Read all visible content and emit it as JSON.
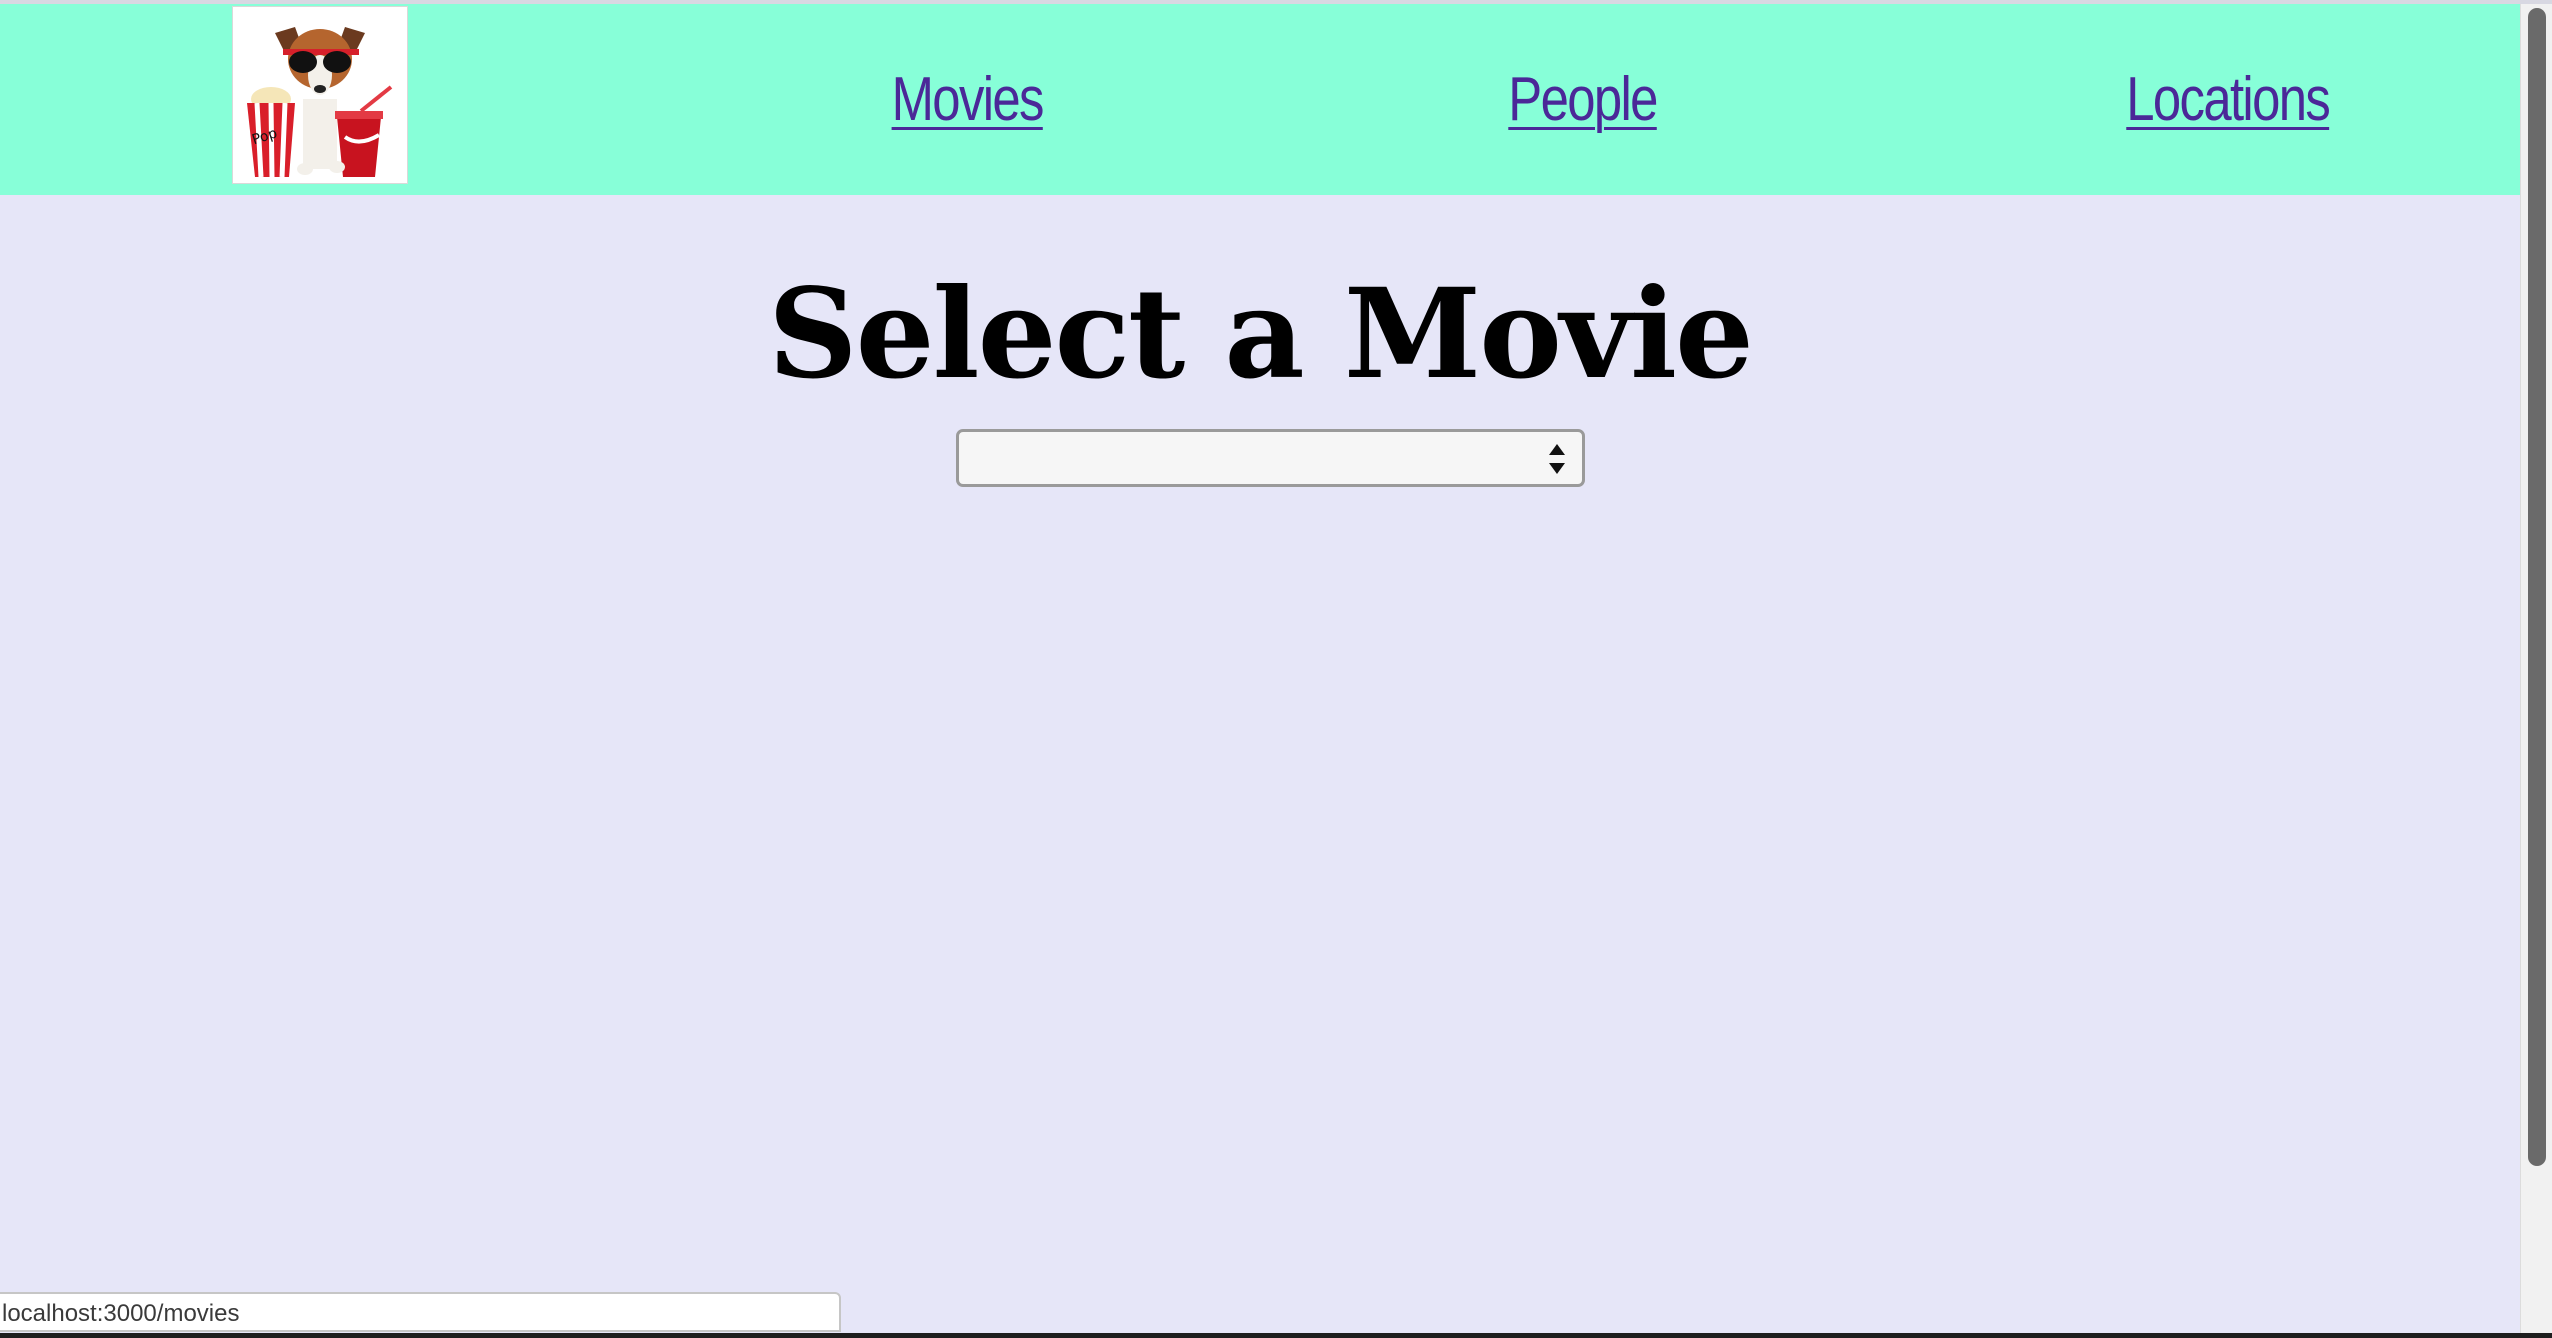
{
  "nav": {
    "links": [
      {
        "label": "Movies"
      },
      {
        "label": "People"
      },
      {
        "label": "Locations"
      }
    ],
    "logo": {
      "icon": "dog-popcorn-logo",
      "text": "Popcorn"
    }
  },
  "main": {
    "title": "Select a Movie",
    "movie_select": {
      "selected": ""
    }
  },
  "status_bar": {
    "url": "localhost:3000/movies"
  },
  "colors": {
    "navbar": "#87ffd8",
    "page_background": "#e6e6f8",
    "link": "#4b2898",
    "select_background": "#f6f6f6"
  }
}
